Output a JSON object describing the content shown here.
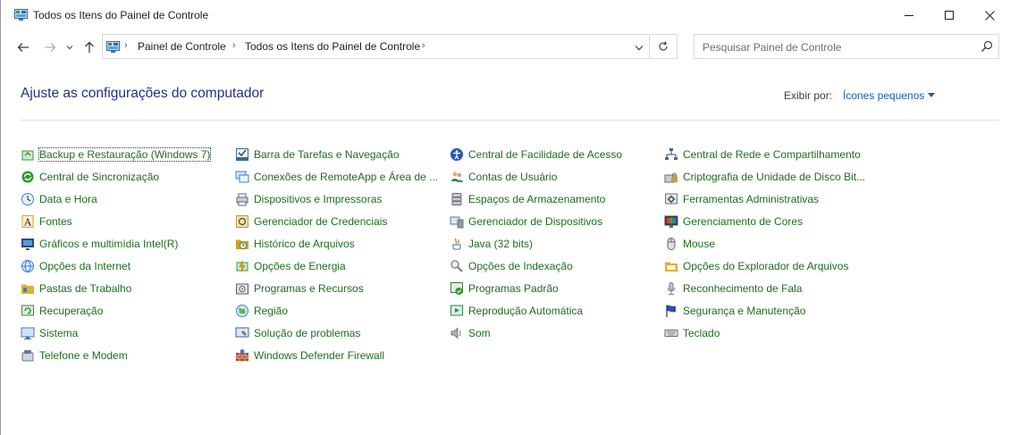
{
  "window": {
    "title": "Todos os Itens do Painel de Controle"
  },
  "address": {
    "breadcrumbs": [
      "Painel de Controle",
      "Todos os Itens do Painel de Controle"
    ]
  },
  "search": {
    "placeholder": "Pesquisar Painel de Controle"
  },
  "page": {
    "heading": "Ajuste as configurações do computador",
    "view_by_label": "Exibir por:",
    "view_by_value": "Ícones pequenos"
  },
  "columns": [
    [
      {
        "label": "Backup e Restauração (Windows 7)",
        "icon": "backup-icon",
        "color": "#3a9a3a"
      },
      {
        "label": "Central de Sincronização",
        "icon": "sync-icon",
        "color": "#2c9a2c"
      },
      {
        "label": "Data e Hora",
        "icon": "clock-icon",
        "color": "#4a7fc0"
      },
      {
        "label": "Fontes",
        "icon": "font-icon",
        "color": "#e0a020"
      },
      {
        "label": "Gráficos e multimídia Intel(R)",
        "icon": "display-icon",
        "color": "#2a4a7a"
      },
      {
        "label": "Opções da Internet",
        "icon": "globe-icon",
        "color": "#3a7fd0"
      },
      {
        "label": "Pastas de Trabalho",
        "icon": "folder-icon",
        "color": "#e0b030"
      },
      {
        "label": "Recuperação",
        "icon": "recovery-icon",
        "color": "#3a8a3a"
      },
      {
        "label": "Sistema",
        "icon": "monitor-icon",
        "color": "#3a7fd0"
      },
      {
        "label": "Telefone e Modem",
        "icon": "phone-icon",
        "color": "#6a7a8a"
      }
    ],
    [
      {
        "label": "Barra de Tarefas e Navegação",
        "icon": "taskbar-icon",
        "color": "#3a6a9a"
      },
      {
        "label": "Conexões de RemoteApp e Área de ...",
        "icon": "remote-icon",
        "color": "#3a7fd0"
      },
      {
        "label": "Dispositivos e Impressoras",
        "icon": "printer-icon",
        "color": "#5a6a7a"
      },
      {
        "label": "Gerenciador de Credenciais",
        "icon": "vault-icon",
        "color": "#c09a40"
      },
      {
        "label": "Histórico de Arquivos",
        "icon": "history-icon",
        "color": "#d0a030"
      },
      {
        "label": "Opções de Energia",
        "icon": "power-icon",
        "color": "#3a9a3a"
      },
      {
        "label": "Programas e Recursos",
        "icon": "programs-icon",
        "color": "#5a5a6a"
      },
      {
        "label": "Região",
        "icon": "region-icon",
        "color": "#3a8ad0"
      },
      {
        "label": "Solução de problemas",
        "icon": "troubleshoot-icon",
        "color": "#3a6a9a"
      },
      {
        "label": "Windows Defender Firewall",
        "icon": "firewall-icon",
        "color": "#b04a2a"
      }
    ],
    [
      {
        "label": "Central de Facilidade de Acesso",
        "icon": "accessibility-icon",
        "color": "#2a5ab0"
      },
      {
        "label": "Contas de Usuário",
        "icon": "users-icon",
        "color": "#3a8a3a"
      },
      {
        "label": "Espaços de Armazenamento",
        "icon": "storage-icon",
        "color": "#6a6a7a"
      },
      {
        "label": "Gerenciador de Dispositivos",
        "icon": "device-manager-icon",
        "color": "#6a7a8a"
      },
      {
        "label": "Java (32 bits)",
        "icon": "java-icon",
        "color": "#d06a2a"
      },
      {
        "label": "Opções de Indexação",
        "icon": "indexing-icon",
        "color": "#7a7a8a"
      },
      {
        "label": "Programas Padrão",
        "icon": "default-programs-icon",
        "color": "#2c9a2c"
      },
      {
        "label": "Reprodução Automática",
        "icon": "autoplay-icon",
        "color": "#2c8a4a"
      },
      {
        "label": "Som",
        "icon": "speaker-icon",
        "color": "#7a7a7a"
      }
    ],
    [
      {
        "label": "Central de Rede e Compartilhamento",
        "icon": "network-icon",
        "color": "#3a6ab0"
      },
      {
        "label": "Criptografia de Unidade de Disco Bit...",
        "icon": "bitlocker-icon",
        "color": "#c0a040"
      },
      {
        "label": "Ferramentas Administrativas",
        "icon": "admin-tools-icon",
        "color": "#6a7a8a"
      },
      {
        "label": "Gerenciamento de Cores",
        "icon": "color-management-icon",
        "color": "#3a7fd0"
      },
      {
        "label": "Mouse",
        "icon": "mouse-icon",
        "color": "#6a6a6a"
      },
      {
        "label": "Opções do Explorador de Arquivos",
        "icon": "folder-options-icon",
        "color": "#e0b030"
      },
      {
        "label": "Reconhecimento de Fala",
        "icon": "microphone-icon",
        "color": "#7a7a8a"
      },
      {
        "label": "Segurança e Manutenção",
        "icon": "flag-icon",
        "color": "#2a4ab0"
      },
      {
        "label": "Teclado",
        "icon": "keyboard-icon",
        "color": "#6a6a6a"
      }
    ]
  ]
}
